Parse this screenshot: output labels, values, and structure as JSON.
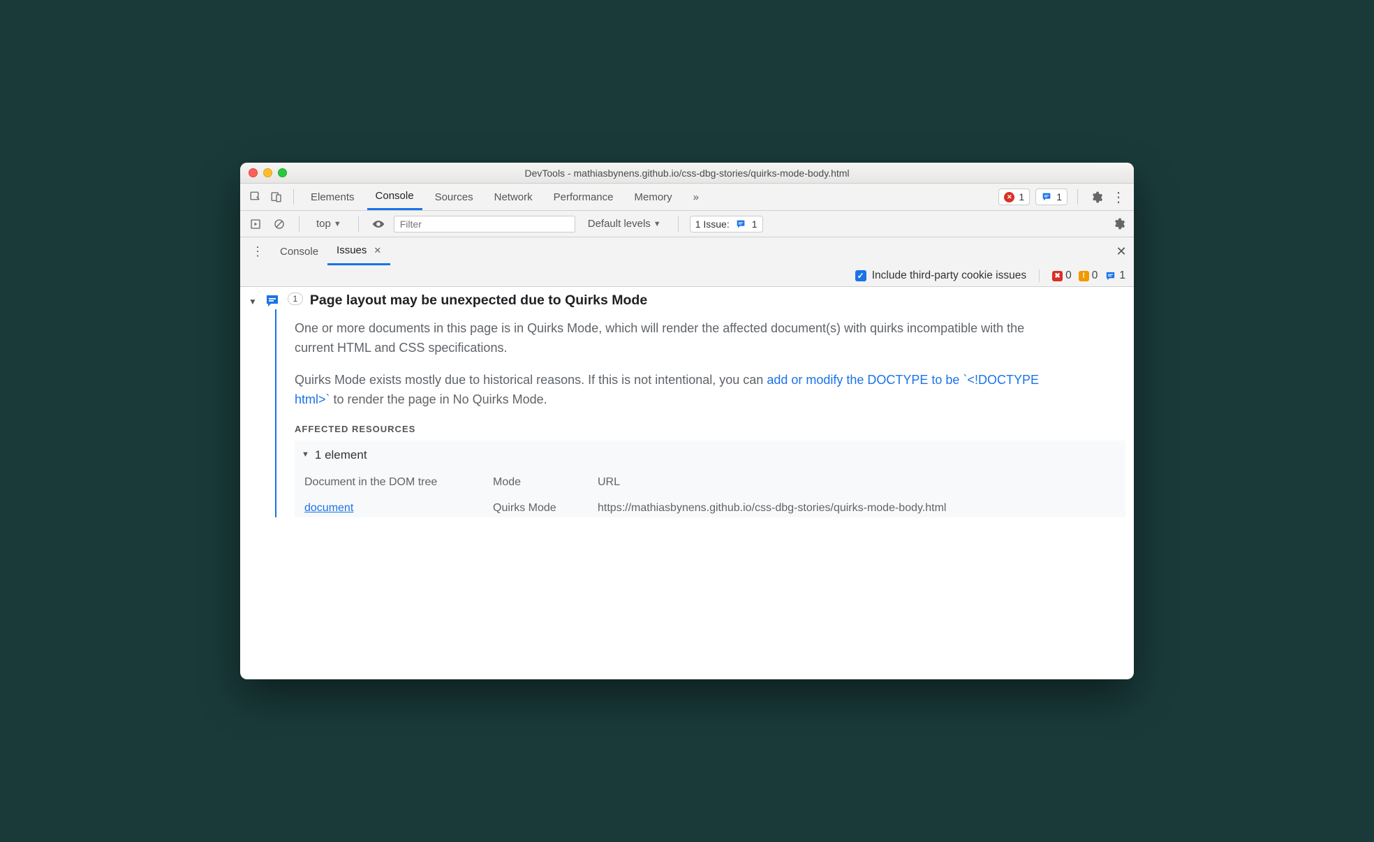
{
  "window": {
    "title": "DevTools - mathiasbynens.github.io/css-dbg-stories/quirks-mode-body.html"
  },
  "tabs": {
    "items": [
      "Elements",
      "Console",
      "Sources",
      "Network",
      "Performance",
      "Memory"
    ],
    "active": "Console",
    "errors": "1",
    "messages": "1"
  },
  "console_bar": {
    "context": "top",
    "filter_placeholder": "Filter",
    "levels_label": "Default levels",
    "issues_label": "1 Issue:",
    "issues_count": "1"
  },
  "subtabs": {
    "items": [
      "Console",
      "Issues"
    ],
    "active": "Issues"
  },
  "issues_options": {
    "third_party_label": "Include third-party cookie issues",
    "counts": {
      "errors": "0",
      "warnings": "0",
      "messages": "1"
    }
  },
  "issue": {
    "count": "1",
    "title": "Page layout may be unexpected due to Quirks Mode",
    "p1": "One or more documents in this page is in Quirks Mode, which will render the affected document(s) with quirks incompatible with the current HTML and CSS specifications.",
    "p2a": "Quirks Mode exists mostly due to historical reasons. If this is not intentional, you can ",
    "p2link": "add or modify the DOCTYPE to be `<!DOCTYPE html>`",
    "p2b": " to render the page in No Quirks Mode.",
    "affected_label": "AFFECTED RESOURCES",
    "affected_count": "1 element",
    "columns": {
      "doc": "Document in the DOM tree",
      "mode": "Mode",
      "url": "URL"
    },
    "row": {
      "doc": "document",
      "mode": "Quirks Mode",
      "url": "https://mathiasbynens.github.io/css-dbg-stories/quirks-mode-body.html"
    }
  }
}
